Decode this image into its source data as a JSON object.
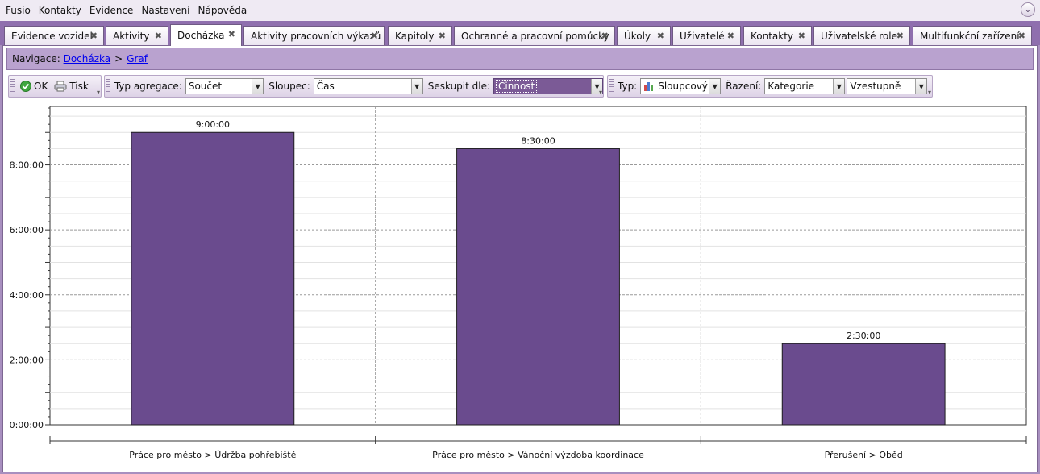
{
  "menu": [
    "Fusio",
    "Kontakty",
    "Evidence",
    "Nastavení",
    "Nápověda"
  ],
  "tabs": [
    {
      "label": "Evidence vozidel",
      "active": false
    },
    {
      "label": "Aktivity",
      "active": false
    },
    {
      "label": "Docházka",
      "active": true
    },
    {
      "label": "Aktivity pracovních výkazů",
      "active": false
    },
    {
      "label": "Kapitoly",
      "active": false
    },
    {
      "label": "Ochranné a pracovní pomůcky",
      "active": false
    },
    {
      "label": "Úkoly",
      "active": false
    },
    {
      "label": "Uživatelé",
      "active": false
    },
    {
      "label": "Kontakty",
      "active": false
    },
    {
      "label": "Uživatelské role",
      "active": false
    },
    {
      "label": "Multifunkční zařízení",
      "active": false
    }
  ],
  "navigation": {
    "label": "Navigace:",
    "crumbs": [
      "Docházka",
      "Graf"
    ],
    "separator": ">"
  },
  "toolbar": {
    "ok_label": "OK",
    "print_label": "Tisk",
    "aggregation_label": "Typ agregace:",
    "aggregation_value": "Součet",
    "column_label": "Sloupec:",
    "column_value": "Čas",
    "group_label": "Seskupit dle:",
    "group_value": "Činnost",
    "type_label": "Typ:",
    "type_value": "Sloupcový",
    "sort_label": "Řazení:",
    "sort_value": "Kategorie",
    "order_value": "Vzestupně"
  },
  "colors": {
    "bar": "#6a4b8e",
    "accent": "#8f6fae"
  },
  "chart_data": {
    "type": "bar",
    "categories": [
      "Práce pro město > Údržba pohřebiště",
      "Práce pro město > Vánoční výzdoba koordinace",
      "Přerušení > Oběd"
    ],
    "values": [
      9.0,
      8.5,
      2.5
    ],
    "data_labels": [
      "9:00:00",
      "8:30:00",
      "2:30:00"
    ],
    "y_ticks": [
      0,
      2,
      4,
      6,
      8
    ],
    "y_tick_labels": [
      "0:00:00",
      "2:00:00",
      "4:00:00",
      "6:00:00",
      "8:00:00"
    ],
    "ylim": [
      0,
      9.8
    ],
    "grid": true
  }
}
